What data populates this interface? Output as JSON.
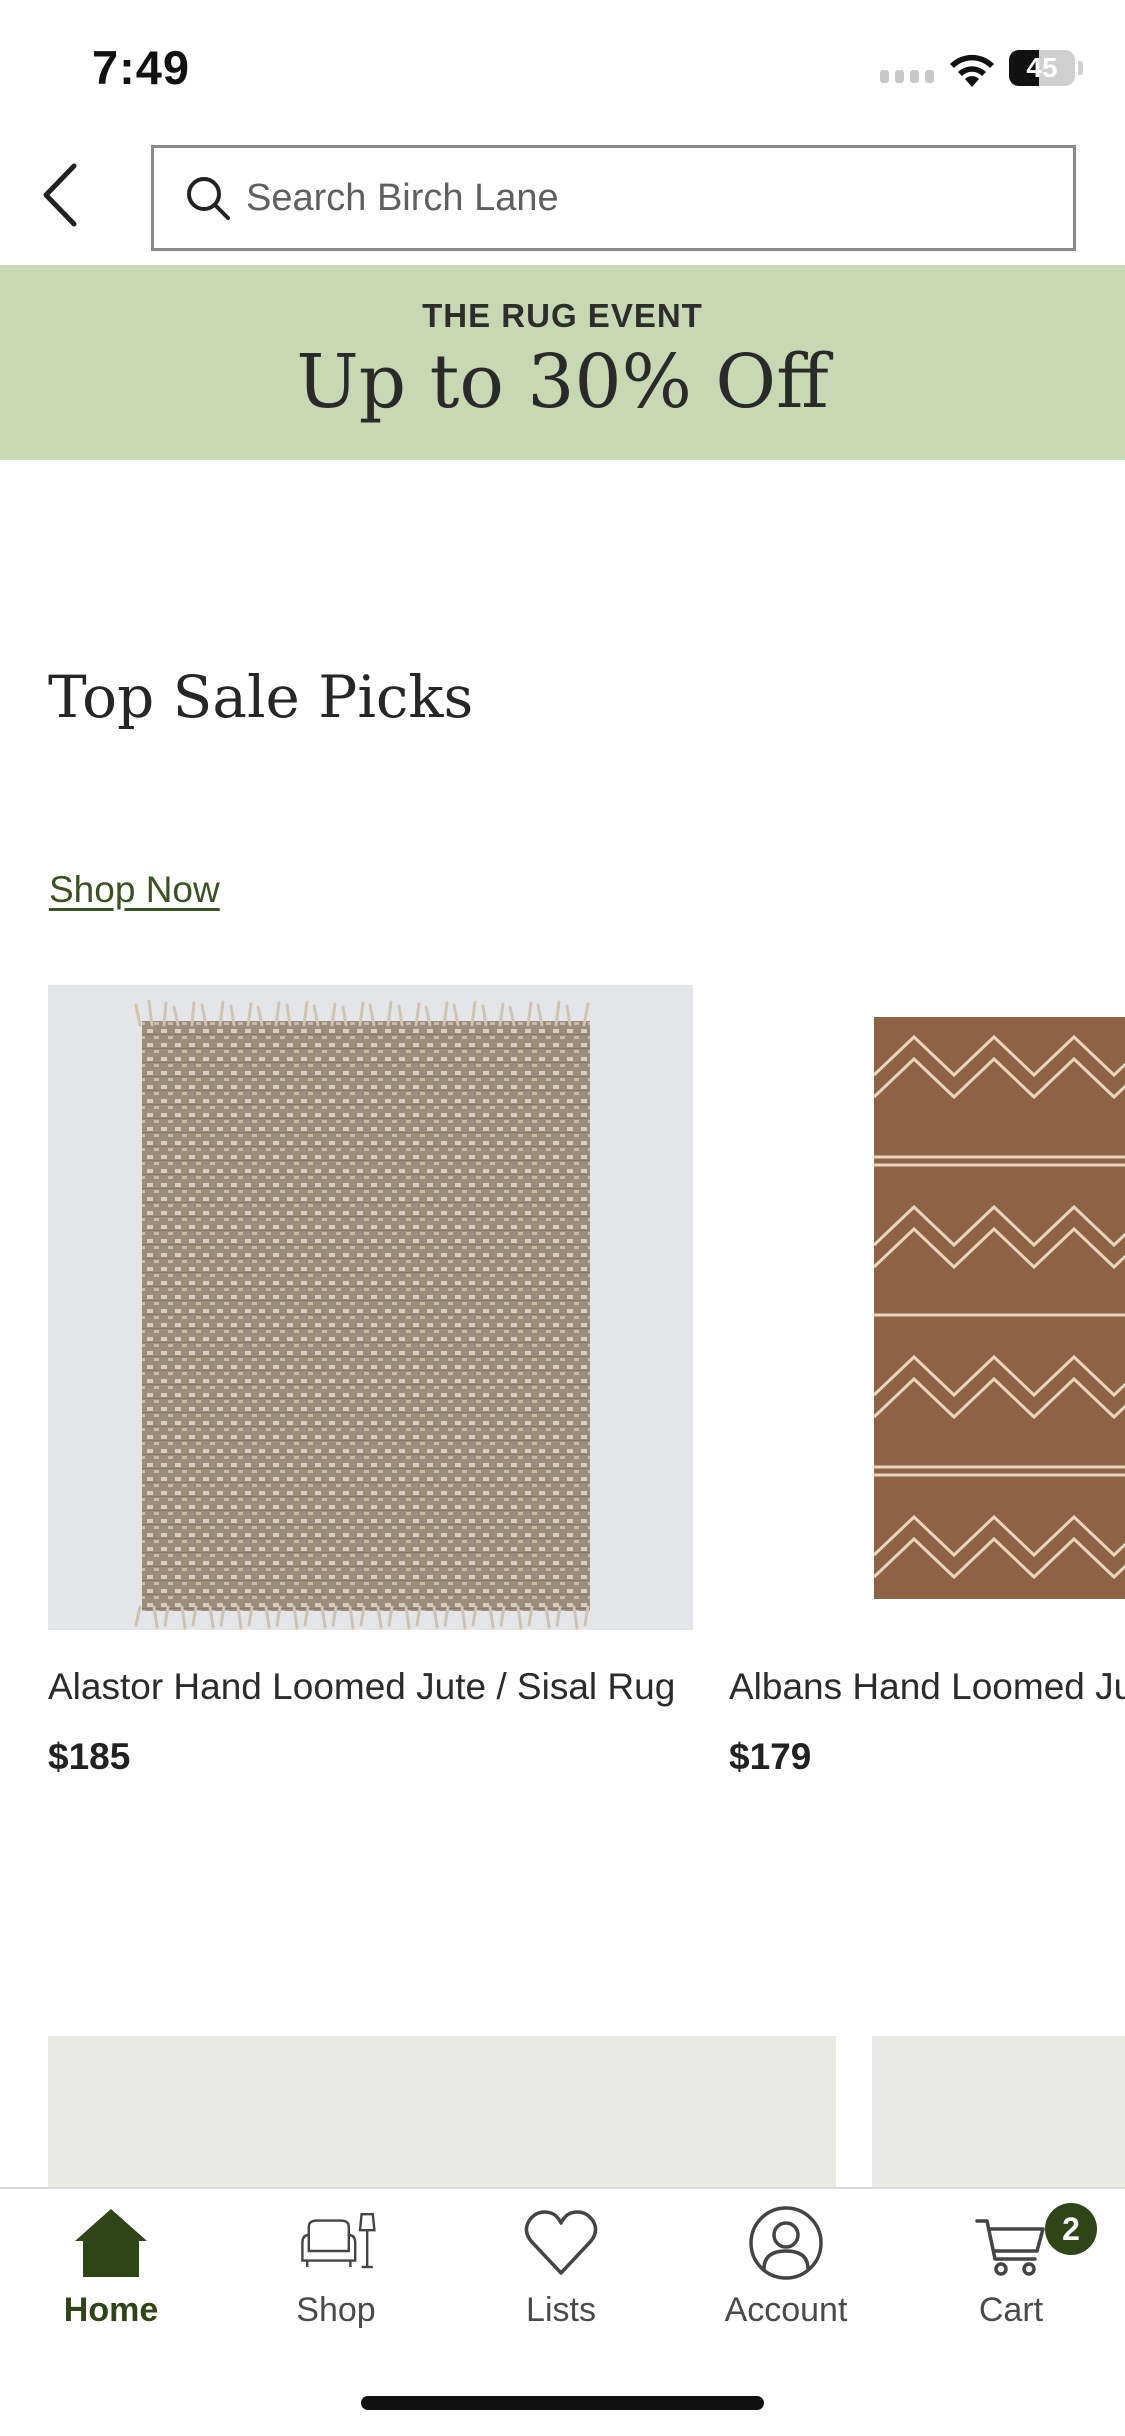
{
  "status_bar": {
    "time": "7:49",
    "battery_level": "45",
    "battery_fraction": 0.45
  },
  "header": {
    "back_icon": "chevron-left-icon",
    "search_placeholder": "Search Birch Lane",
    "search_icon": "search-icon"
  },
  "promo": {
    "eyebrow": "THE RUG EVENT",
    "headline": "Up to 30% Off",
    "background_color": "#c8d8b2"
  },
  "section": {
    "title": "Top Sale Picks",
    "link_label": "Shop Now"
  },
  "products": [
    {
      "name": "Alastor Hand Loomed Jute / Sisal Rug",
      "price": "$185",
      "image": "woven-jute-rug-with-fringe"
    },
    {
      "name": "Albans Hand Loomed Jute / Sisal Rug",
      "price": "$179",
      "image": "brown-jute-rug-zigzag-pattern"
    }
  ],
  "tab_bar": {
    "items": [
      {
        "label": "Home",
        "icon": "home-icon",
        "active": true
      },
      {
        "label": "Shop",
        "icon": "sofa-lamp-icon",
        "active": false
      },
      {
        "label": "Lists",
        "icon": "heart-icon",
        "active": false
      },
      {
        "label": "Account",
        "icon": "account-icon",
        "active": false
      },
      {
        "label": "Cart",
        "icon": "cart-icon",
        "active": false
      }
    ],
    "cart_count": "2",
    "accent_color": "#2f4417"
  }
}
